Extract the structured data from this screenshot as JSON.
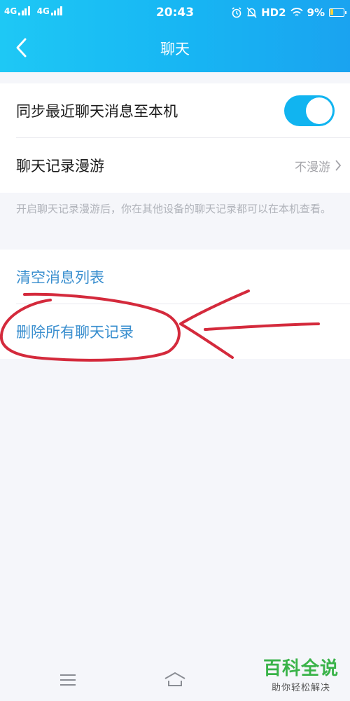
{
  "status_bar": {
    "signal1_label": "4G",
    "signal2_label": "4G",
    "time": "20:43",
    "hd_label": "HD2",
    "battery_percent": "9%"
  },
  "header": {
    "title": "聊天",
    "back_icon": "chevron-left-icon"
  },
  "settings": {
    "sync_label": "同步最近聊天消息至本机",
    "sync_enabled": true,
    "roaming_label": "聊天记录漫游",
    "roaming_value": "不漫游",
    "roaming_hint": "开启聊天记录漫游后，你在其他设备的聊天记录都可以在本机查看。"
  },
  "actions": {
    "clear_list_label": "清空消息列表",
    "delete_all_label": "删除所有聊天记录"
  },
  "colors": {
    "header_bg": "#17b5f3",
    "toggle_on": "#11b4f0",
    "link_text": "#3a8fcf",
    "annotation": "#d42a3c",
    "page_bg": "#f5f6fa"
  },
  "watermark": {
    "title": "百科全说",
    "subtitle": "助你轻松解决"
  }
}
